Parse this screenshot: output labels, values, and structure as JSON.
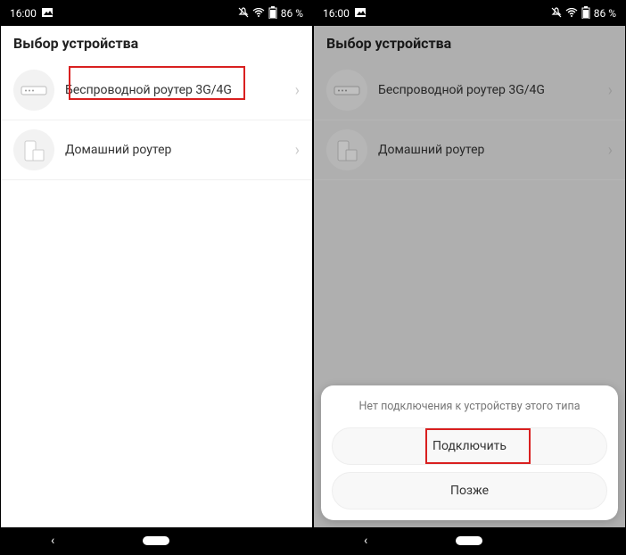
{
  "status": {
    "time": "16:00",
    "battery": "86 %"
  },
  "header": {
    "title": "Выбор устройства"
  },
  "devices": {
    "wireless_3g4g": {
      "label": "Беспроводной роутер 3G/4G"
    },
    "home_router": {
      "label": "Домашний роутер"
    }
  },
  "dialog": {
    "message": "Нет подключения к устройству этого типа",
    "connect": "Подключить",
    "later": "Позже"
  }
}
